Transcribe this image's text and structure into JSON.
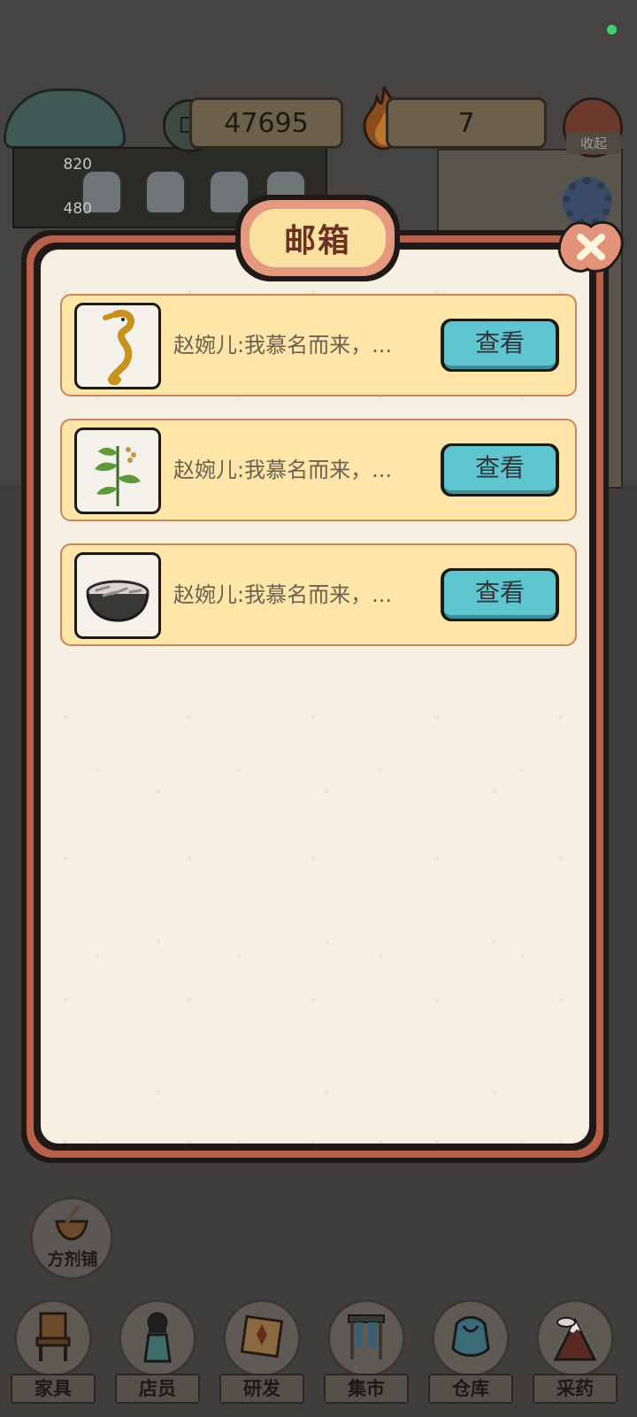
{
  "top_bar": {
    "coins": "47695",
    "fire": "7",
    "fold_label": "收起",
    "stat_1": "820",
    "stat_2": "480"
  },
  "modal": {
    "title": "邮箱",
    "mails": [
      {
        "preview": "赵婉儿:我慕名而来，...",
        "item_icon": "seahorse-icon",
        "view_label": "查看"
      },
      {
        "preview": "赵婉儿:我慕名而来，...",
        "item_icon": "herb-plant-icon",
        "view_label": "查看"
      },
      {
        "preview": "赵婉儿:我慕名而来，...",
        "item_icon": "bowl-icon",
        "view_label": "查看"
      }
    ]
  },
  "side_button": {
    "label": "方剂铺"
  },
  "bottom_nav": [
    {
      "label": "家具",
      "icon": "chair-icon"
    },
    {
      "label": "店员",
      "icon": "clerk-icon"
    },
    {
      "label": "研发",
      "icon": "research-icon"
    },
    {
      "label": "集市",
      "icon": "market-icon"
    },
    {
      "label": "仓库",
      "icon": "warehouse-icon"
    },
    {
      "label": "采药",
      "icon": "mountain-icon"
    }
  ],
  "colors": {
    "accent_red": "#b8604a",
    "mail_card": "#fde6a8",
    "view_button": "#5fc6d0",
    "title_text": "#6b3122"
  }
}
